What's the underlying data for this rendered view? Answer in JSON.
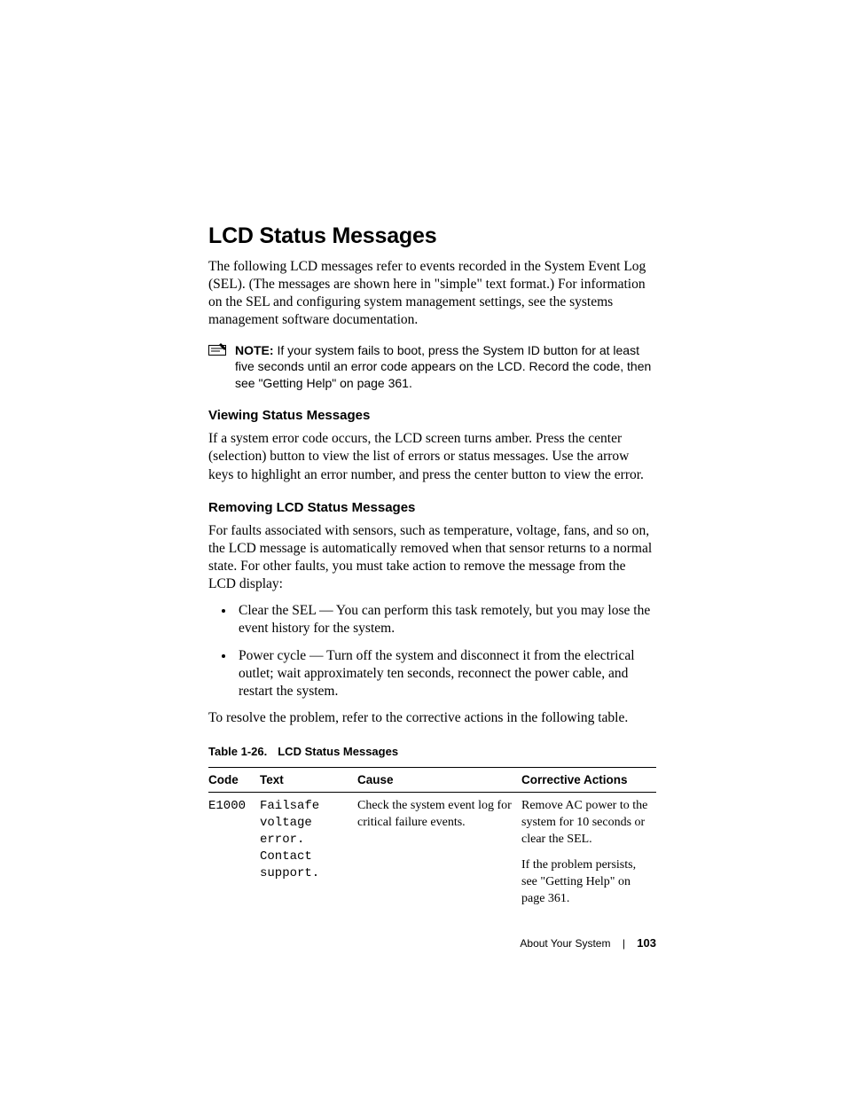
{
  "heading": "LCD Status Messages",
  "intro": "The following LCD messages refer to events recorded in the System Event Log (SEL). (The messages are shown here in \"simple\" text format.) For information on the SEL and configuring system management settings, see the systems management software documentation.",
  "note": {
    "label": "NOTE:",
    "text": " If your system fails to boot, press the System ID button for at least five seconds until an error code appears on the LCD. Record the code, then see \"Getting Help\" on page 361."
  },
  "sections": {
    "viewing": {
      "title": "Viewing Status Messages",
      "body": "If a system error code occurs, the LCD screen turns amber. Press the center (selection) button to view the list of errors or status messages. Use the arrow keys to highlight an error number, and press the center button to view the error."
    },
    "removing": {
      "title": "Removing LCD Status Messages",
      "intro": "For faults associated with sensors, such as temperature, voltage, fans, and so on, the LCD message is automatically removed when that sensor returns to a normal state. For other faults, you must take action to remove the message from the LCD display:",
      "bullets": [
        "Clear the SEL — You can perform this task remotely, but you may lose the event history for the system.",
        "Power cycle — Turn off the system and disconnect it from the electrical outlet; wait approximately ten seconds, reconnect the power cable, and restart the system."
      ],
      "outro": "To resolve the problem, refer to the corrective actions in the following table."
    }
  },
  "table": {
    "caption_number": "Table 1-26.",
    "caption_title": "LCD Status Messages",
    "columns": [
      "Code",
      "Text",
      "Cause",
      "Corrective Actions"
    ],
    "rows": [
      {
        "code": "E1000",
        "text": "Failsafe voltage error. Contact support.",
        "cause": "Check the system event log for critical failure events.",
        "corrective": [
          "Remove AC power to the system for 10 seconds or clear the SEL.",
          "If the problem persists, see \"Getting Help\" on page 361."
        ]
      }
    ]
  },
  "footer": {
    "section": "About Your System",
    "page": "103"
  }
}
